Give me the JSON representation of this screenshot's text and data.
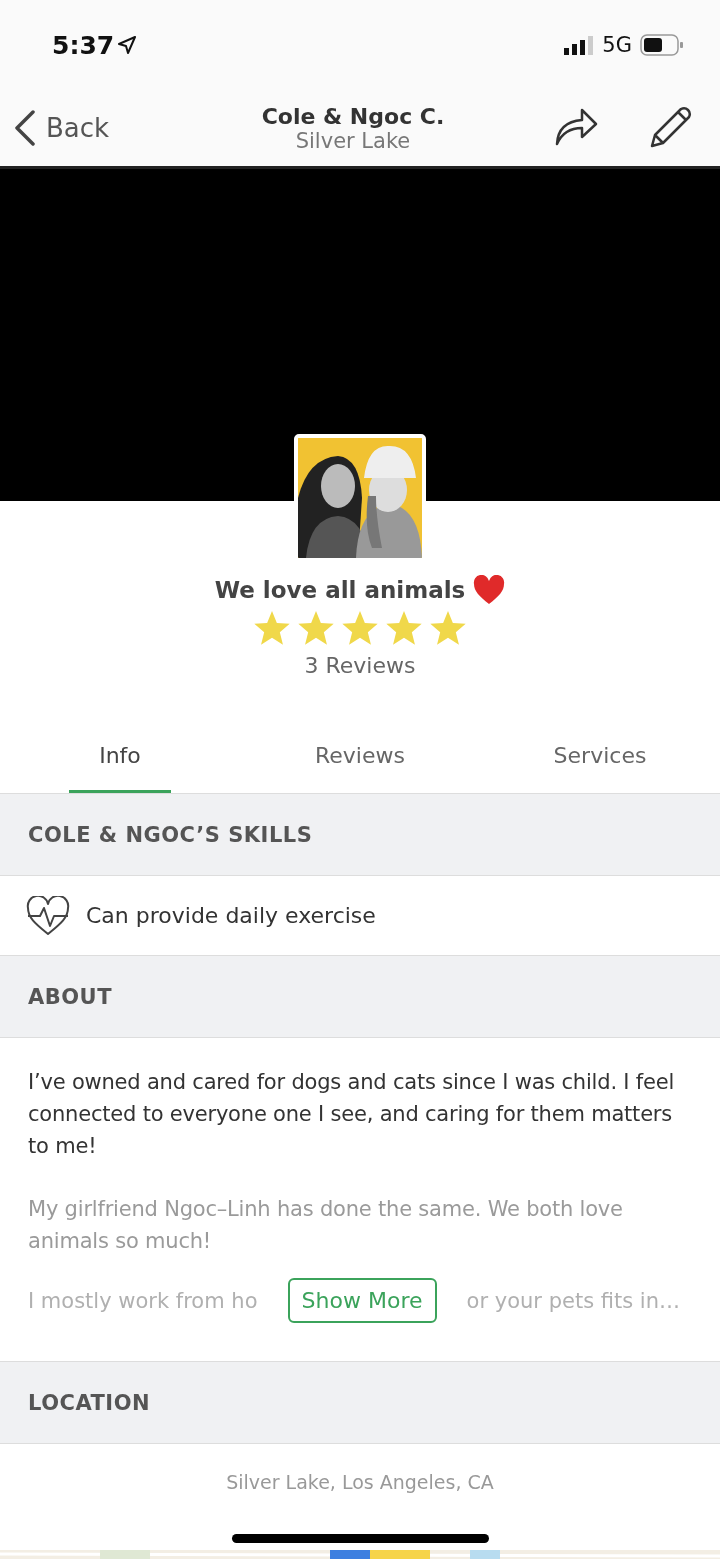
{
  "status_bar": {
    "time": "5:37",
    "network": "5G"
  },
  "nav": {
    "back": "Back",
    "title": "Cole & Ngoc C.",
    "subtitle": "Silver Lake"
  },
  "profile": {
    "tagline": "We love all animals",
    "stars": 5,
    "reviews": "3 Reviews"
  },
  "tabs": [
    {
      "label": "Info",
      "selected": true
    },
    {
      "label": "Reviews",
      "selected": false
    },
    {
      "label": "Services",
      "selected": false
    }
  ],
  "skills": {
    "heading": "COLE & NGOC’S SKILLS",
    "items": [
      "Can provide daily exercise"
    ]
  },
  "about": {
    "heading": "ABOUT",
    "paragraphs": [
      "I’ve owned and cared for dogs and cats since I was child. I feel connected to everyone one I see, and caring for them matters to me!",
      "My girlfriend Ngoc–Linh has done the same. We both love animals so much!"
    ],
    "cut_left": "I mostly work from ho",
    "cut_right": "or your pets fits in…",
    "button": "Show More"
  },
  "location": {
    "heading": "LOCATION",
    "place": "Silver Lake, Los Angeles, CA"
  }
}
